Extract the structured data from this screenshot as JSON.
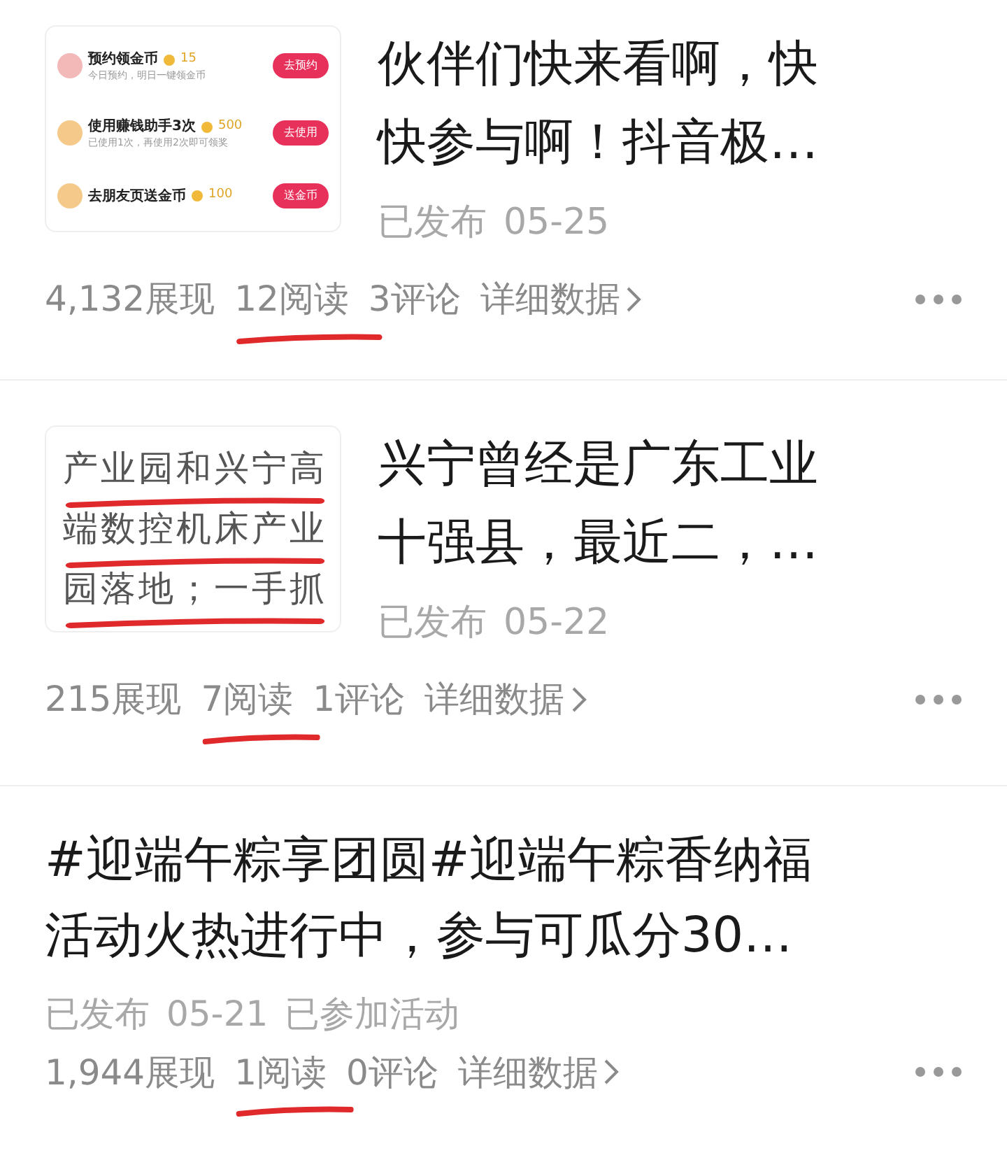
{
  "posts": [
    {
      "thumbnail": {
        "kind": "tasks",
        "tasks": [
          {
            "title": "预约领金币",
            "coins": "15",
            "note": "今日预约，明日一键领金币",
            "button": "去预约",
            "color": "#f3b8b8"
          },
          {
            "title": "使用赚钱助手3次",
            "coins": "500",
            "note": "已使用1次，再使用2次即可领奖",
            "button": "去使用",
            "color": "#f5c98a"
          },
          {
            "title": "去朋友页送金币",
            "coins": "100",
            "button": "送金币",
            "color": "#f5c98a"
          }
        ]
      },
      "title_lines": [
        "伙伴们快来看啊，快",
        "快参与啊！抖音极…"
      ],
      "status": "已发布",
      "date": "05-25",
      "stats": [
        {
          "text": "4,132展现",
          "marked": false
        },
        {
          "text": "12阅读",
          "marked": true
        },
        {
          "text": "3评论",
          "marked": false
        }
      ],
      "details": "详细数据"
    },
    {
      "thumbnail": {
        "kind": "text",
        "lines": [
          {
            "text": "产业园和兴宁高",
            "underlined": true
          },
          {
            "text": "端数控机床产业",
            "underlined": true
          },
          {
            "text": "园落地；一手抓",
            "underlined": true
          }
        ]
      },
      "title_lines": [
        "兴宁曾经是广东工业",
        "十强县，最近二，…"
      ],
      "status": "已发布",
      "date": "05-22",
      "stats": [
        {
          "text": "215展现",
          "marked": false
        },
        {
          "text": "7阅读",
          "marked": true
        },
        {
          "text": "1评论",
          "marked": false
        }
      ],
      "details": "详细数据"
    },
    {
      "title_lines": [
        "#迎端午粽享团圆#迎端午粽香纳福",
        "活动火热进行中，参与可瓜分30…"
      ],
      "status": "已发布",
      "date": "05-21",
      "activity": "已参加活动",
      "stats": [
        {
          "text": "1,944展现",
          "marked": false
        },
        {
          "text": "1阅读",
          "marked": true
        },
        {
          "text": "0评论",
          "marked": false
        }
      ],
      "details": "详细数据"
    }
  ]
}
